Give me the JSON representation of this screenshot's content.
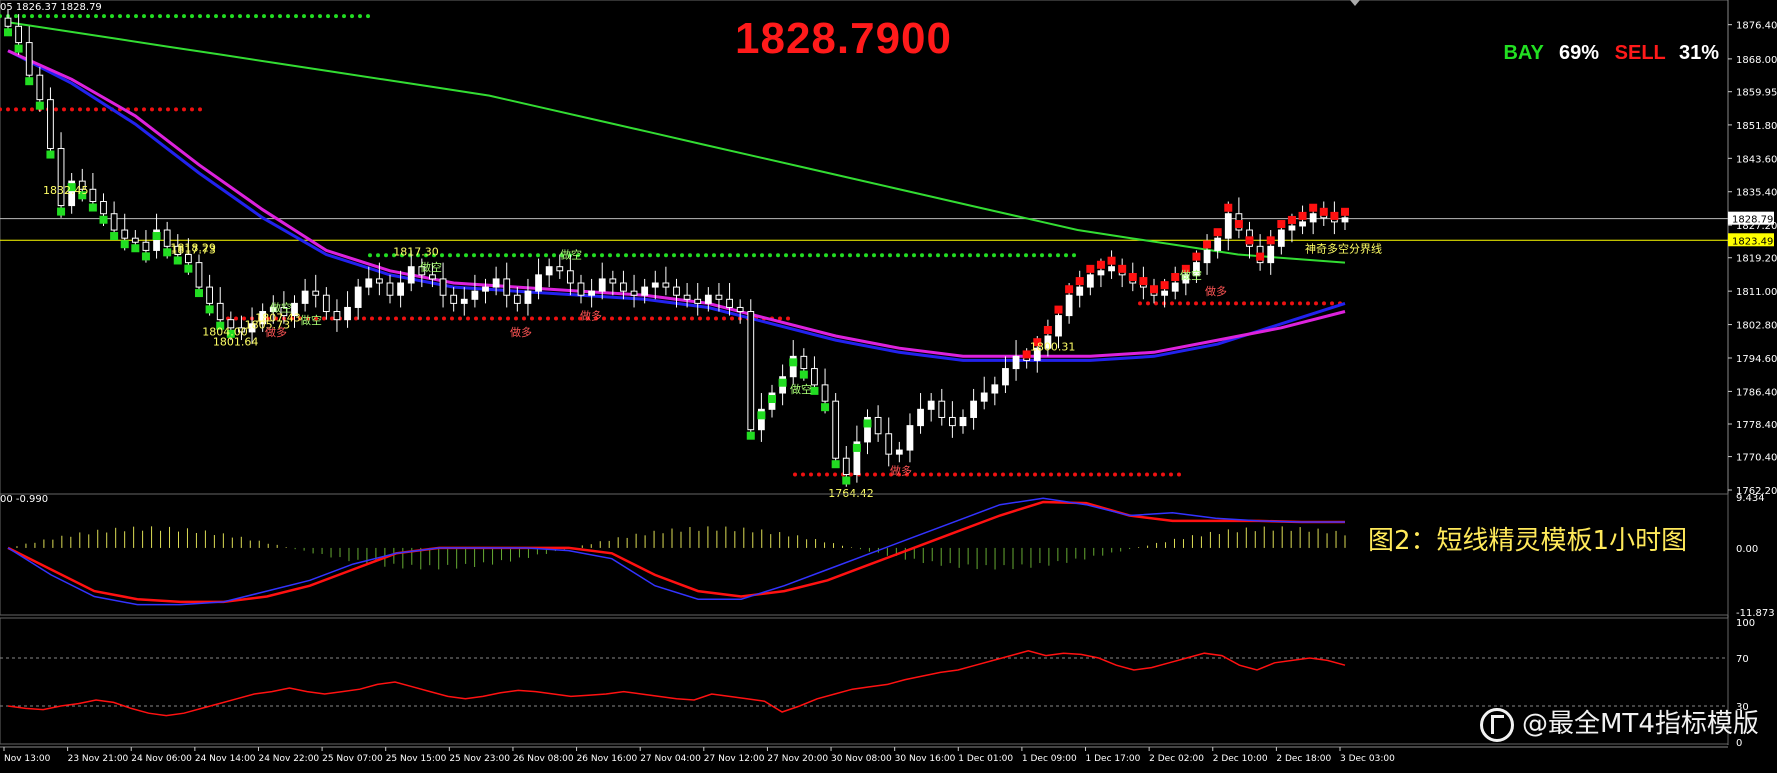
{
  "header": {
    "ohlc_text": "05 1826.37 1828.79",
    "big_price": "1828.7900",
    "bay_label": "BAY",
    "bay_pct": "69%",
    "sell_label": "SELL",
    "sell_pct": "31%"
  },
  "caption": "图2：短线精灵模板1小时图",
  "watermark": "@最全MT4指标模版",
  "indicator_header": "00 -0.990",
  "colors": {
    "background": "#000000",
    "bull_candle": "#ffffff",
    "bear_candle": "#ffffff",
    "green_dots": "#22dd22",
    "red_dots": "#ee1111",
    "ma_long": "#33dd33",
    "ma_blue": "#2222ee",
    "ma_magenta": "#dd22dd",
    "signal_red": "#ff1111",
    "signal_blue": "#3333ff",
    "yellow_text": "#ffff66",
    "axis_text": "#ffffff",
    "current_price_line": "#bbbbbb",
    "boundary_line": "#ffff00"
  },
  "chart_data": [
    {
      "type": "candlestick",
      "title": "",
      "ylim": [
        1762.2,
        1880.0
      ],
      "y_ticks": [
        "1876.40",
        "1868.00",
        "1859.95",
        "1851.80",
        "1843.60",
        "1835.40",
        "1827.20",
        "1819.20",
        "1811.00",
        "1802.80",
        "1794.60",
        "1786.40",
        "1778.40",
        "1770.40",
        "1762.20"
      ],
      "x_ticks": [
        "Nov 13:00",
        "23 Nov 21:00",
        "24 Nov 06:00",
        "24 Nov 14:00",
        "24 Nov 22:00",
        "25 Nov 07:00",
        "25 Nov 15:00",
        "25 Nov 23:00",
        "26 Nov 08:00",
        "26 Nov 16:00",
        "27 Nov 04:00",
        "27 Nov 12:00",
        "27 Nov 20:00",
        "30 Nov 08:00",
        "30 Nov 16:00",
        "1 Dec 01:00",
        "1 Dec 09:00",
        "1 Dec 17:00",
        "2 Dec 02:00",
        "2 Dec 10:00",
        "2 Dec 18:00",
        "3 Dec 03:00"
      ],
      "current_price": "1828.79",
      "boundary_price": "1823.49",
      "boundary_label": "神奇多空分界线",
      "annotations": [
        {
          "text": "1817.73",
          "value": 1817.73
        },
        {
          "text": "1818.29",
          "value": 1818.29
        },
        {
          "text": "1800.31",
          "value": 1800.31
        },
        {
          "text": "1801.64",
          "value": 1801.64
        },
        {
          "text": "1804.00",
          "value": 1804.0
        },
        {
          "text": "1805.73",
          "value": 1805.73
        },
        {
          "text": "1764.42",
          "value": 1764.42
        },
        {
          "text": "1817.30",
          "value": 1817.3
        },
        {
          "text": "1807.43",
          "value": 1807.43
        },
        {
          "text": "1832.45",
          "value": 1832.45
        }
      ],
      "signal_labels": [
        "做空",
        "做多",
        "做空",
        "做空",
        "做多",
        "做空",
        "做多",
        "做空",
        "做多",
        "做多",
        "做空"
      ],
      "close_series": [
        1876,
        1872,
        1864,
        1858,
        1846,
        1832,
        1838,
        1836,
        1833,
        1830,
        1826,
        1824,
        1823,
        1821,
        1826,
        1822,
        1820,
        1818,
        1812,
        1808,
        1804,
        1802,
        1801,
        1803,
        1806,
        1807,
        1805,
        1808,
        1811,
        1810,
        1806,
        1804,
        1807,
        1812,
        1814,
        1813,
        1810,
        1813,
        1817,
        1815,
        1814,
        1810,
        1808,
        1809,
        1811,
        1812,
        1814,
        1810,
        1808,
        1811,
        1815,
        1817,
        1816,
        1813,
        1810,
        1811,
        1814,
        1813,
        1811,
        1810,
        1812,
        1813,
        1812,
        1810,
        1809,
        1808,
        1810,
        1809,
        1807,
        1806,
        1777,
        1782,
        1786,
        1790,
        1795,
        1792,
        1788,
        1784,
        1770,
        1766,
        1774,
        1780,
        1776,
        1771,
        1772,
        1778,
        1782,
        1784,
        1780,
        1778,
        1780,
        1784,
        1786,
        1788,
        1792,
        1795,
        1794,
        1797,
        1800,
        1805,
        1810,
        1812,
        1815,
        1816,
        1817,
        1815,
        1813,
        1812,
        1810,
        1811,
        1813,
        1815,
        1818,
        1821,
        1824,
        1830,
        1826,
        1822,
        1818,
        1822,
        1826,
        1827,
        1828,
        1830,
        1829,
        1828,
        1829
      ],
      "series": [
        {
          "name": "",
          "color": "#33dd33",
          "values": [
            1877,
            1875,
            1873,
            1871,
            1869,
            1867,
            1865,
            1863,
            1861,
            1859,
            1856,
            1853,
            1850,
            1847,
            1844,
            1841,
            1838,
            1835,
            1832,
            1829,
            1826,
            1824,
            1822,
            1820,
            1819,
            1818
          ]
        },
        {
          "name": "",
          "color": "#2222ee",
          "values": [
            1870,
            1862,
            1852,
            1840,
            1829,
            1820,
            1815,
            1812,
            1811,
            1810,
            1809,
            1807,
            1803,
            1799,
            1796,
            1794,
            1794,
            1794,
            1795,
            1798,
            1803,
            1808
          ]
        },
        {
          "name": "",
          "color": "#dd22dd",
          "values": [
            1870,
            1863,
            1854,
            1842,
            1831,
            1821,
            1816,
            1813,
            1812,
            1811,
            1810,
            1808,
            1804,
            1800,
            1797,
            1795,
            1795,
            1795,
            1796,
            1799,
            1802,
            1806
          ]
        }
      ],
      "green_dot_levels": [
        1878.5,
        1819.8
      ],
      "red_dot_levels": [
        1855.6,
        1804.3,
        1766.0,
        1808.0
      ]
    },
    {
      "type": "line",
      "title": "",
      "ylim": [
        -11.873,
        9.434
      ],
      "y_ticks": [
        "9.434",
        "0.00",
        "-11.873"
      ],
      "series": [
        {
          "name": "",
          "color": "#ff1111",
          "values": [
            0,
            -4,
            -8,
            -9.5,
            -10,
            -10,
            -9,
            -7,
            -4,
            -1,
            0,
            0,
            0,
            0,
            -1,
            -5,
            -8,
            -9,
            -8,
            -6,
            -3,
            0,
            3,
            6,
            8.5,
            8.3,
            6,
            5,
            5,
            5,
            4.8,
            4.8
          ]
        },
        {
          "name": "",
          "color": "#3333ff",
          "values": [
            0,
            -5,
            -9,
            -10.5,
            -10.5,
            -10,
            -8,
            -6,
            -3,
            -1,
            0,
            0,
            0,
            -0.5,
            -2,
            -7,
            -9.5,
            -9.5,
            -7,
            -4,
            -1,
            2,
            5,
            8,
            9.2,
            8,
            6,
            6.5,
            5.5,
            5,
            4.8,
            4.8
          ]
        }
      ]
    },
    {
      "type": "line",
      "title": "",
      "ylim": [
        0,
        100
      ],
      "y_ticks": [
        "100",
        "70",
        "30",
        "0"
      ],
      "levels": [
        70,
        30
      ],
      "series": [
        {
          "name": "",
          "color": "#ff1111",
          "values": [
            30,
            28,
            27,
            30,
            32,
            35,
            33,
            28,
            24,
            22,
            24,
            28,
            32,
            36,
            40,
            42,
            45,
            42,
            40,
            42,
            44,
            48,
            50,
            46,
            42,
            38,
            36,
            38,
            41,
            43,
            42,
            40,
            38,
            39,
            40,
            42,
            40,
            38,
            36,
            35,
            40,
            38,
            36,
            34,
            25,
            30,
            36,
            40,
            44,
            46,
            48,
            52,
            55,
            58,
            60,
            64,
            68,
            72,
            76,
            72,
            74,
            73,
            70,
            64,
            60,
            62,
            66,
            70,
            74,
            72,
            64,
            60,
            66,
            68,
            70,
            68,
            64
          ]
        }
      ]
    }
  ]
}
